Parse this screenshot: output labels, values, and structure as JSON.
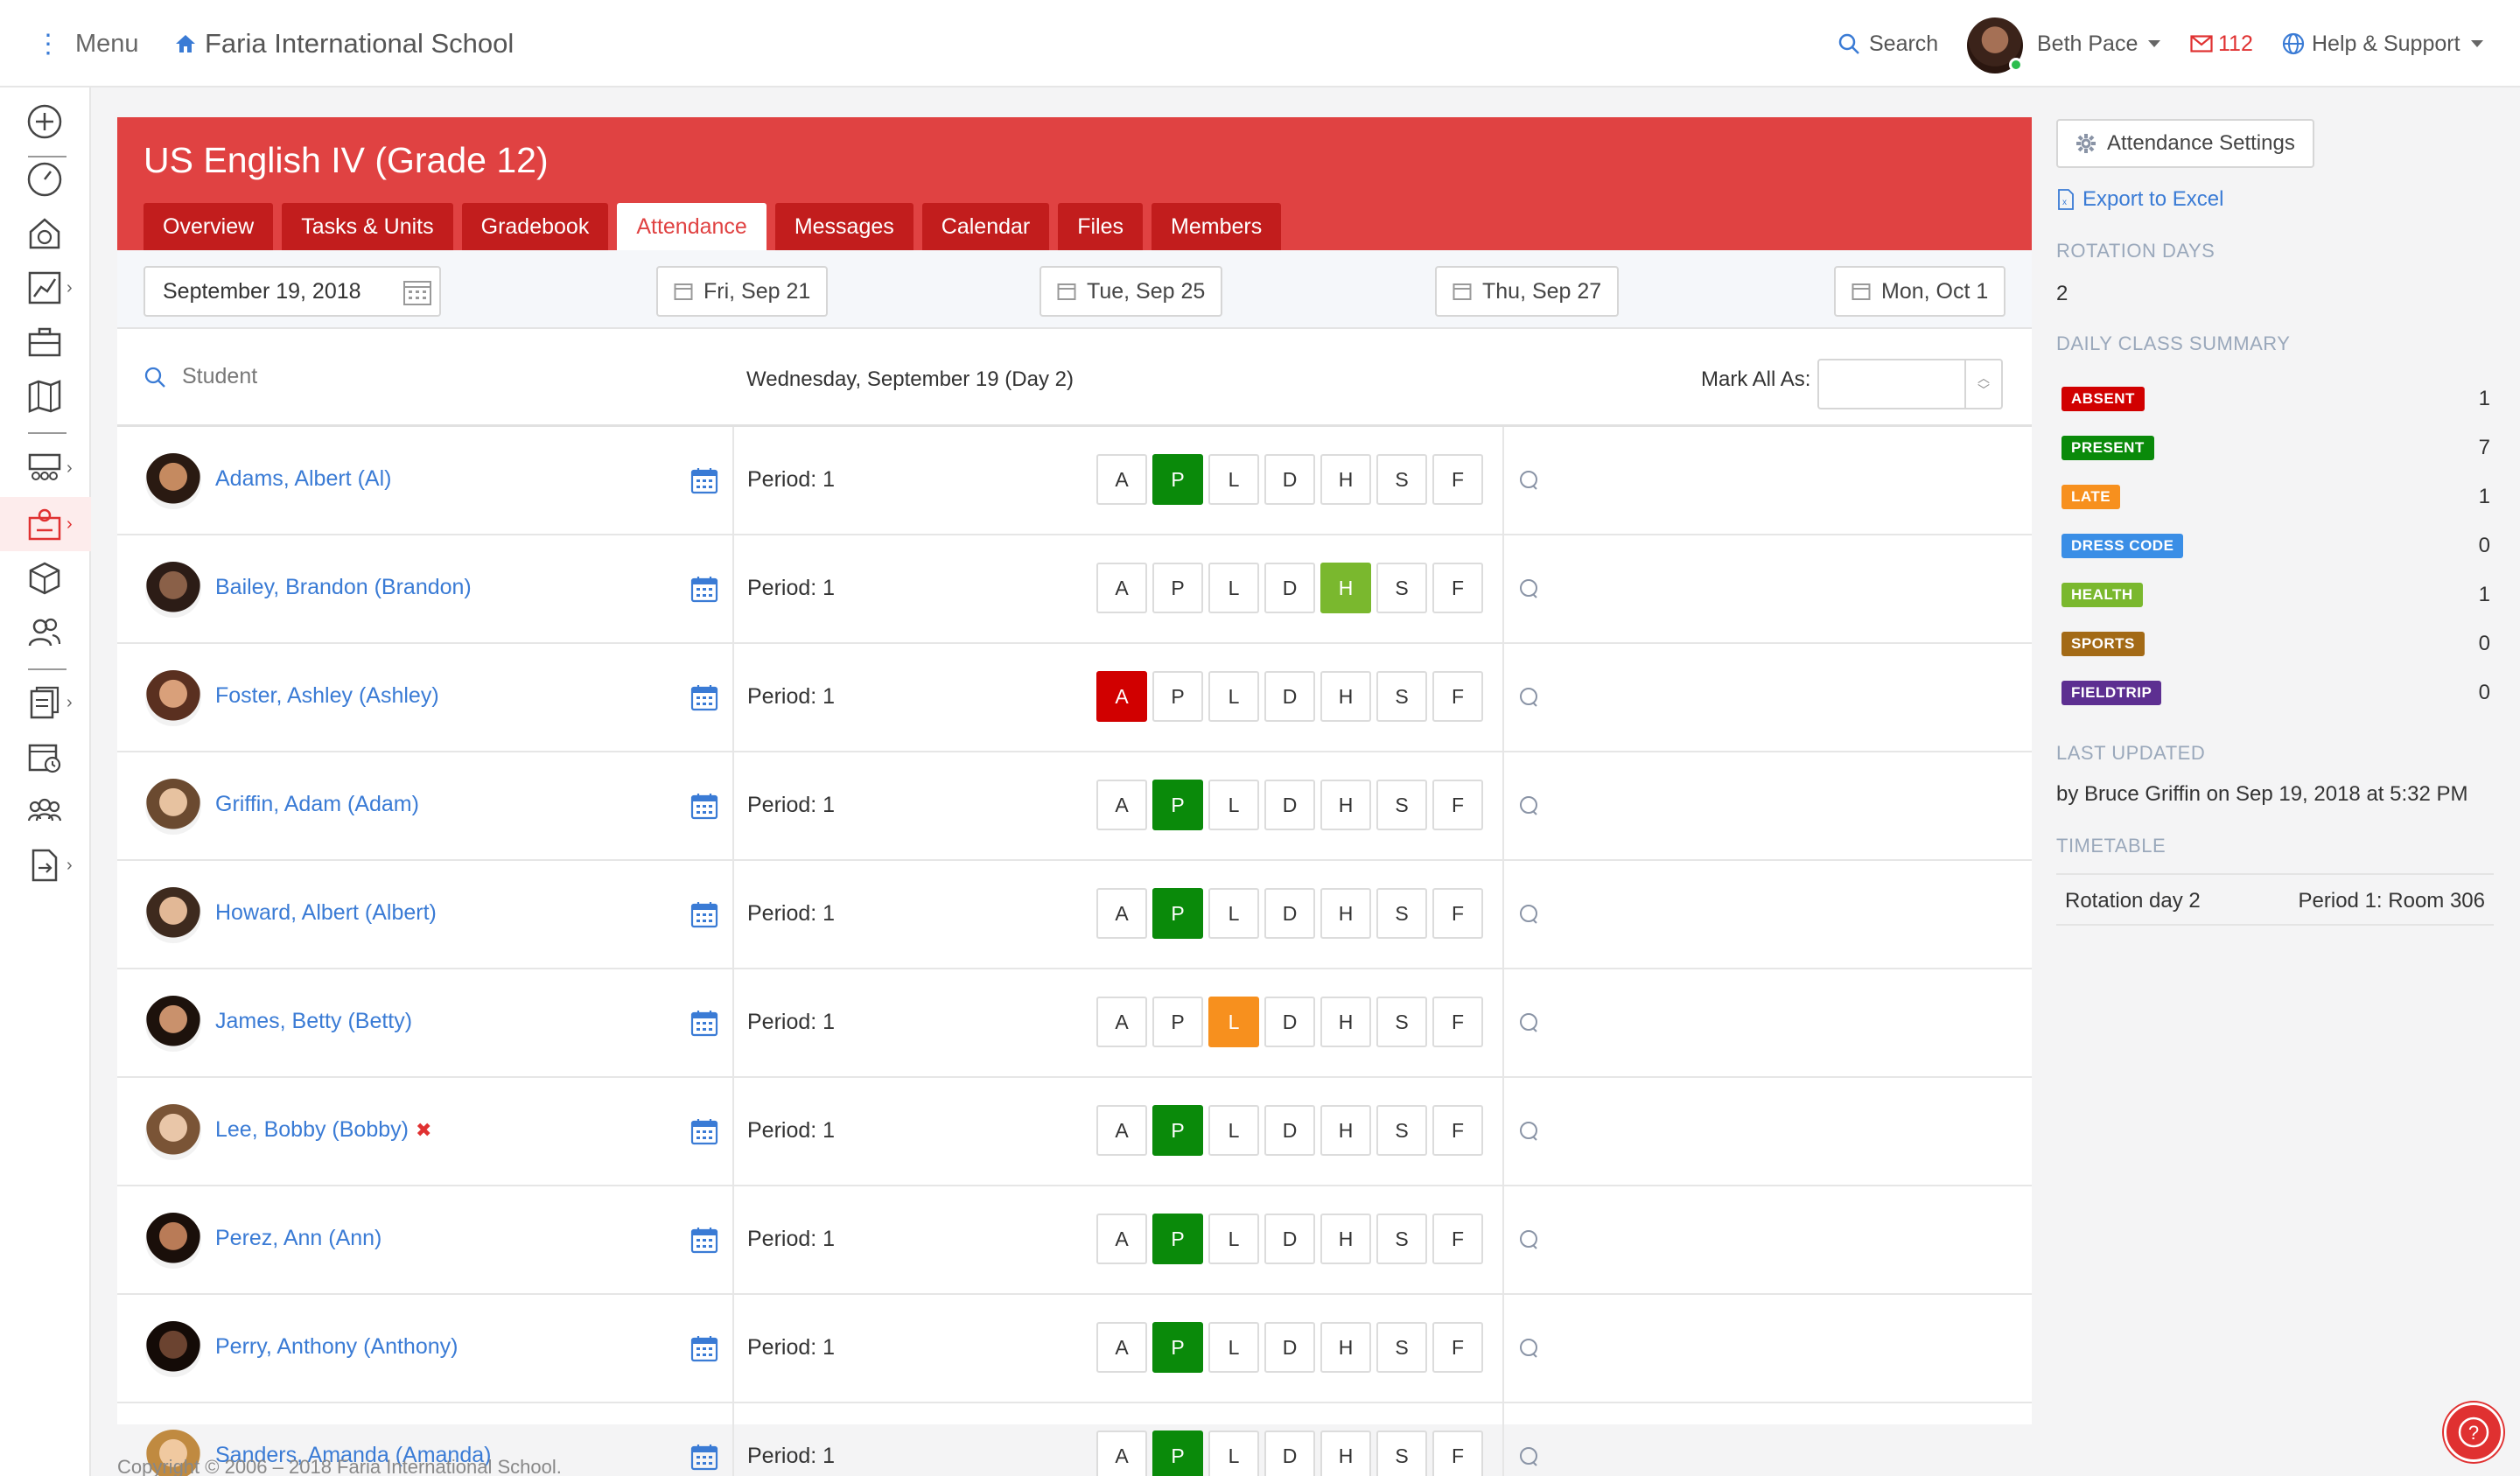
{
  "topbar": {
    "menu_label": "Menu",
    "school_name": "Faria International School",
    "search_label": "Search",
    "user_name": "Beth Pace",
    "mail_count": "112",
    "help_label": "Help & Support"
  },
  "course": {
    "title": "US English IV (Grade 12)",
    "tabs": [
      {
        "label": "Overview"
      },
      {
        "label": "Tasks & Units"
      },
      {
        "label": "Gradebook"
      },
      {
        "label": "Attendance"
      },
      {
        "label": "Messages"
      },
      {
        "label": "Calendar"
      },
      {
        "label": "Files"
      },
      {
        "label": "Members"
      }
    ],
    "active_tab": "Attendance"
  },
  "datebar": {
    "selected_date": "September 19, 2018",
    "quick_dates": [
      "Fri, Sep 21",
      "Tue, Sep 25",
      "Thu, Sep 27",
      "Mon, Oct 1"
    ]
  },
  "table": {
    "student_header": "Student",
    "date_header": "Wednesday, September 19 (Day 2)",
    "mark_all_label": "Mark All As:",
    "mark_all_value": "",
    "codes": [
      "A",
      "P",
      "L",
      "D",
      "H",
      "S",
      "F"
    ],
    "rows": [
      {
        "name": "Adams, Albert (Al)",
        "period": "Period: 1",
        "status": "P",
        "flag": ""
      },
      {
        "name": "Bailey, Brandon (Brandon)",
        "period": "Period: 1",
        "status": "H",
        "flag": ""
      },
      {
        "name": "Foster, Ashley (Ashley)",
        "period": "Period: 1",
        "status": "A",
        "flag": ""
      },
      {
        "name": "Griffin, Adam (Adam)",
        "period": "Period: 1",
        "status": "P",
        "flag": ""
      },
      {
        "name": "Howard, Albert (Albert)",
        "period": "Period: 1",
        "status": "P",
        "flag": ""
      },
      {
        "name": "James, Betty (Betty)",
        "period": "Period: 1",
        "status": "L",
        "flag": ""
      },
      {
        "name": "Lee, Bobby (Bobby)",
        "period": "Period: 1",
        "status": "P",
        "flag": "✖"
      },
      {
        "name": "Perez, Ann (Ann)",
        "period": "Period: 1",
        "status": "P",
        "flag": ""
      },
      {
        "name": "Perry, Anthony (Anthony)",
        "period": "Period: 1",
        "status": "P",
        "flag": ""
      },
      {
        "name": "Sanders, Amanda (Amanda)",
        "period": "Period: 1",
        "status": "P",
        "flag": ""
      }
    ]
  },
  "panel": {
    "settings_label": "Attendance Settings",
    "export_label": "Export to Excel",
    "rotation_heading": "ROTATION DAYS",
    "rotation_value": "2",
    "summary_heading": "DAILY CLASS SUMMARY",
    "summary": [
      {
        "label": "ABSENT",
        "count": "1",
        "color": "#d10000"
      },
      {
        "label": "PRESENT",
        "count": "7",
        "color": "#0a8a0a"
      },
      {
        "label": "LATE",
        "count": "1",
        "color": "#f7901e"
      },
      {
        "label": "DRESS CODE",
        "count": "0",
        "color": "#3a8ee6"
      },
      {
        "label": "HEALTH",
        "count": "1",
        "color": "#7ab82e"
      },
      {
        "label": "SPORTS",
        "count": "0",
        "color": "#a36a16"
      },
      {
        "label": "FIELDTRIP",
        "count": "0",
        "color": "#5d2f91"
      }
    ],
    "updated_heading": "LAST UPDATED",
    "updated_text": "by Bruce Griffin on Sep 19, 2018 at 5:32 PM",
    "timetable_heading": "TIMETABLE",
    "timetable_left": "Rotation day 2",
    "timetable_right": "Period 1: Room 306"
  },
  "footer": {
    "copyright": "Copyright © 2006 – 2018 Faria International School."
  },
  "colors": {
    "brand_red": "#e04242",
    "tab_red": "#c21d1d",
    "link_blue": "#3a7bd5"
  }
}
